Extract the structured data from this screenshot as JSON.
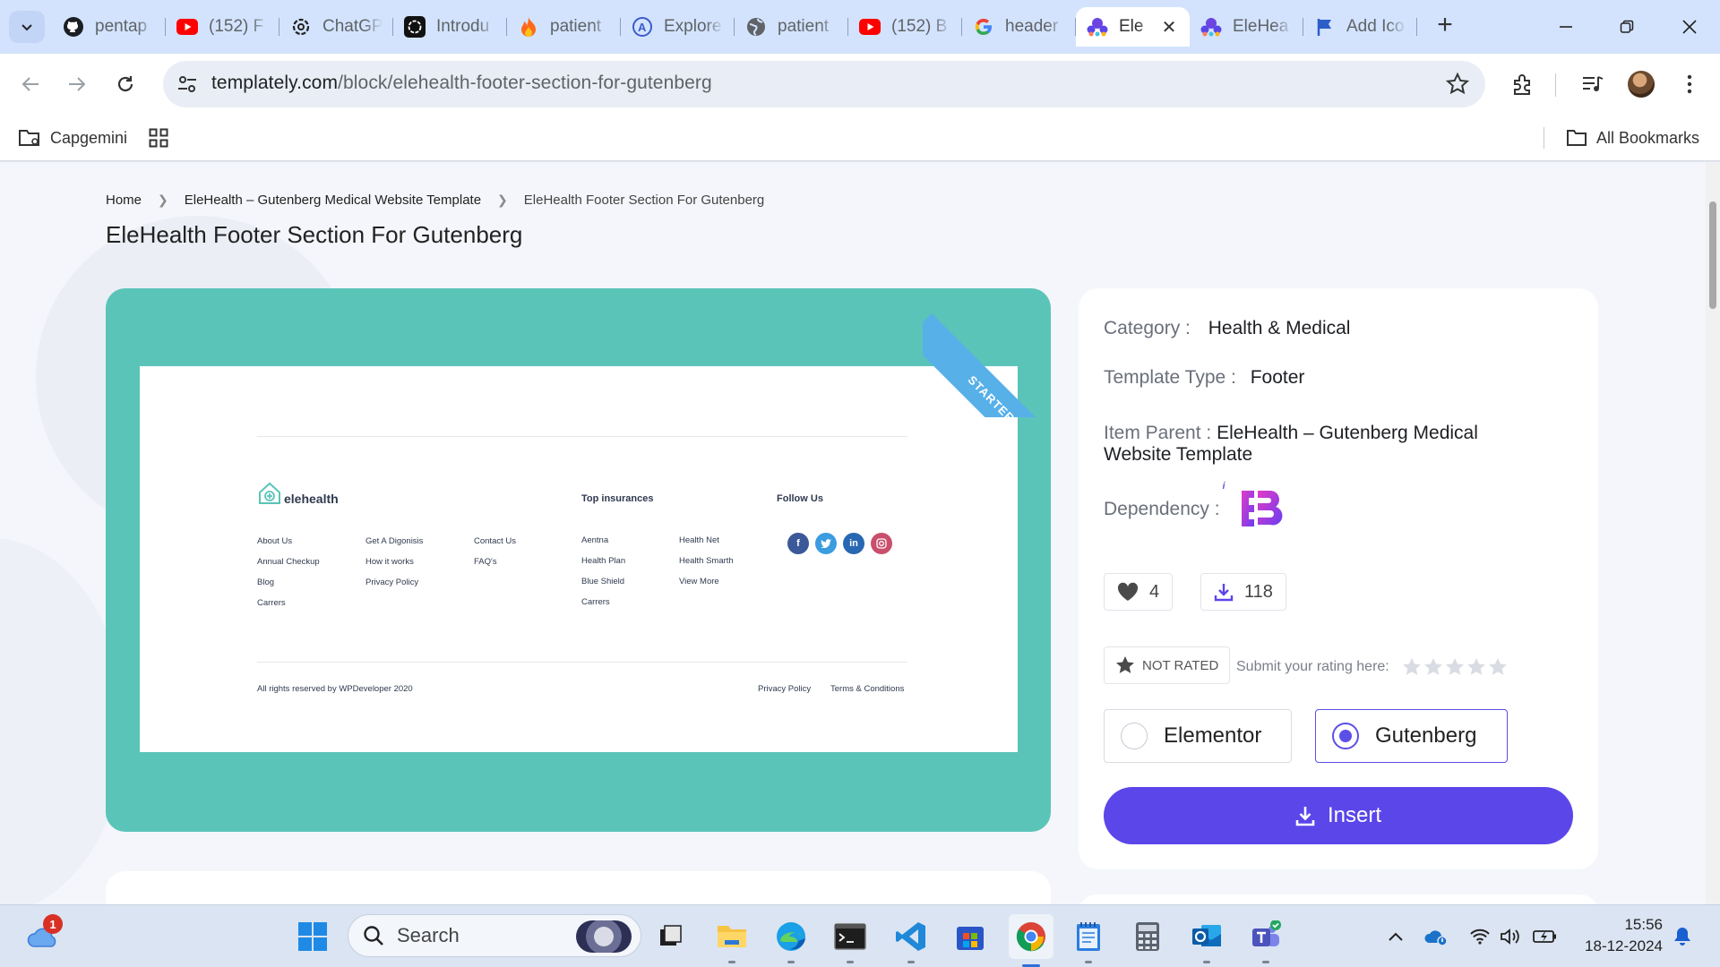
{
  "browser": {
    "tabs": [
      {
        "label": "pentap",
        "icon": "github-icon"
      },
      {
        "label": "(152) F",
        "icon": "youtube-icon"
      },
      {
        "label": "ChatGP",
        "icon": "openai-icon"
      },
      {
        "label": "Introdu",
        "icon": "openai-icon"
      },
      {
        "label": "patient",
        "icon": "flame-icon"
      },
      {
        "label": "Explore",
        "icon": "compass-icon"
      },
      {
        "label": "patient",
        "icon": "globe-icon"
      },
      {
        "label": "(152) B",
        "icon": "youtube-icon"
      },
      {
        "label": "header",
        "icon": "google-icon"
      },
      {
        "label": "Ele",
        "icon": "templately-icon",
        "active": true
      },
      {
        "label": "EleHea",
        "icon": "templately-icon"
      },
      {
        "label": "Add Ico",
        "icon": "flag-icon"
      }
    ],
    "url_domain": "templately.com",
    "url_path": "/block/elehealth-footer-section-for-gutenberg",
    "bookmarks": {
      "capgemini": "Capgemini",
      "all": "All Bookmarks"
    }
  },
  "page": {
    "breadcrumb": {
      "home": "Home",
      "parent": "EleHealth – Gutenberg Medical Website Template",
      "current": "EleHealth Footer Section For Gutenberg"
    },
    "title": "EleHealth Footer Section For Gutenberg",
    "ribbon": "STARTER",
    "preview": {
      "logo": "elehealth",
      "top_insurances": "Top insurances",
      "follow_us": "Follow Us",
      "col1": [
        "About Us",
        "Annual Checkup",
        "Blog",
        "Carrers"
      ],
      "col2": [
        "Get A Digonisis",
        "How it works",
        "Privacy Policy"
      ],
      "col3": [
        "Contact Us",
        "FAQ's"
      ],
      "col4": [
        "Aentna",
        "Health Plan",
        "Blue Shield",
        "Carrers"
      ],
      "col5": [
        "Health Net",
        "Health Smarth",
        "View More"
      ],
      "copyright": "All rights reserved by WPDeveloper 2020",
      "privacy": "Privacy Policy",
      "terms": "Terms & Conditions"
    },
    "info": {
      "category_label": "Category :",
      "category_value": "Health & Medical",
      "type_label": "Template Type :",
      "type_value": "Footer",
      "parent_label": "Item Parent :",
      "parent_value": "EleHealth – Gutenberg Medical Website Template",
      "dependency_label": "Dependency :",
      "likes": "4",
      "downloads": "118",
      "not_rated": "NOT RATED",
      "submit_rating": "Submit your rating here:",
      "builder_elementor": "Elementor",
      "builder_gutenberg": "Gutenberg",
      "selected_builder": "Gutenberg",
      "insert": "Insert",
      "accent": "#5b46ea",
      "preview_bg": "#5bc4b9"
    }
  },
  "taskbar": {
    "search": "Search",
    "notification_badge": "1",
    "time": "15:56",
    "date": "18-12-2024"
  }
}
